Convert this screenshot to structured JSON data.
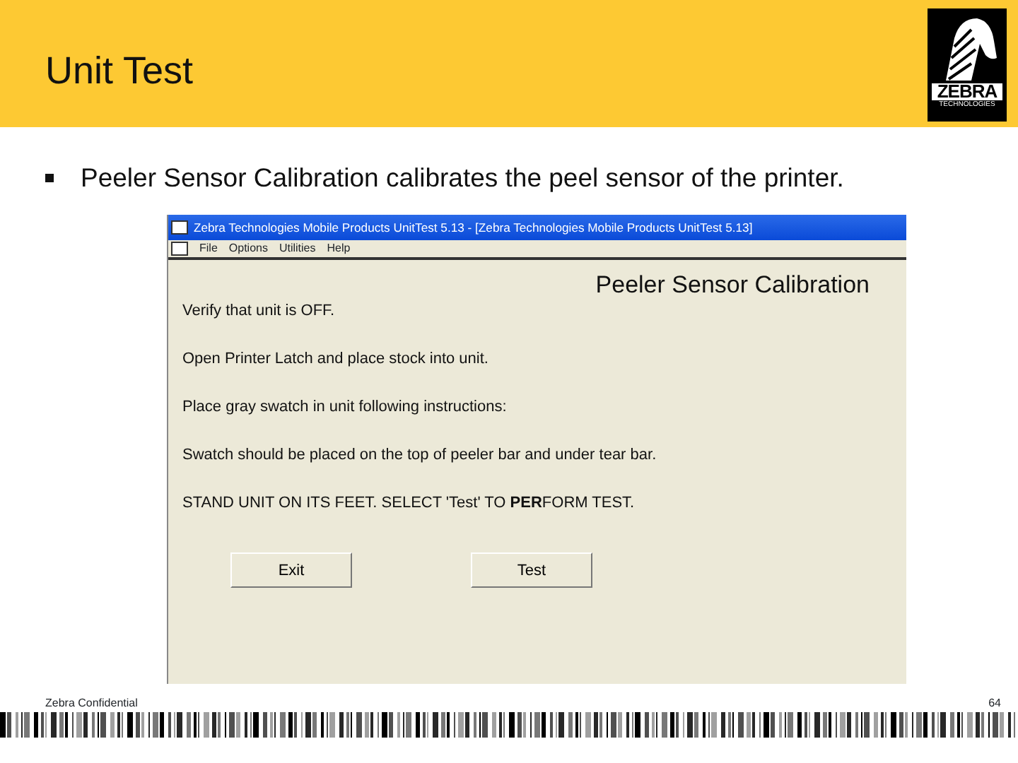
{
  "slide": {
    "title": "Unit Test",
    "logo": {
      "name": "ZEBRA",
      "tagline": "TECHNOLOGIES"
    },
    "bullets": [
      "Peeler Sensor Calibration calibrates the peel sensor of the printer."
    ],
    "footer": "Zebra Confidential",
    "page_number": "64"
  },
  "window": {
    "title": "Zebra Technologies Mobile Products UnitTest 5.13 - [Zebra Technologies Mobile Products UnitTest 5.13]",
    "menu": [
      "File",
      "Options",
      "Utilities",
      "Help"
    ],
    "heading": "Peeler Sensor Calibration",
    "instructions": [
      "Verify that unit is OFF.",
      "Open Printer Latch and place stock into unit.",
      "Place gray swatch in unit following instructions:",
      "Swatch should be placed on the top of peeler bar and under tear bar.",
      "STAND UNIT ON ITS FEET. SELECT 'Test' TO **PER**FORM TEST."
    ],
    "buttons": [
      "Exit",
      "Test"
    ]
  }
}
